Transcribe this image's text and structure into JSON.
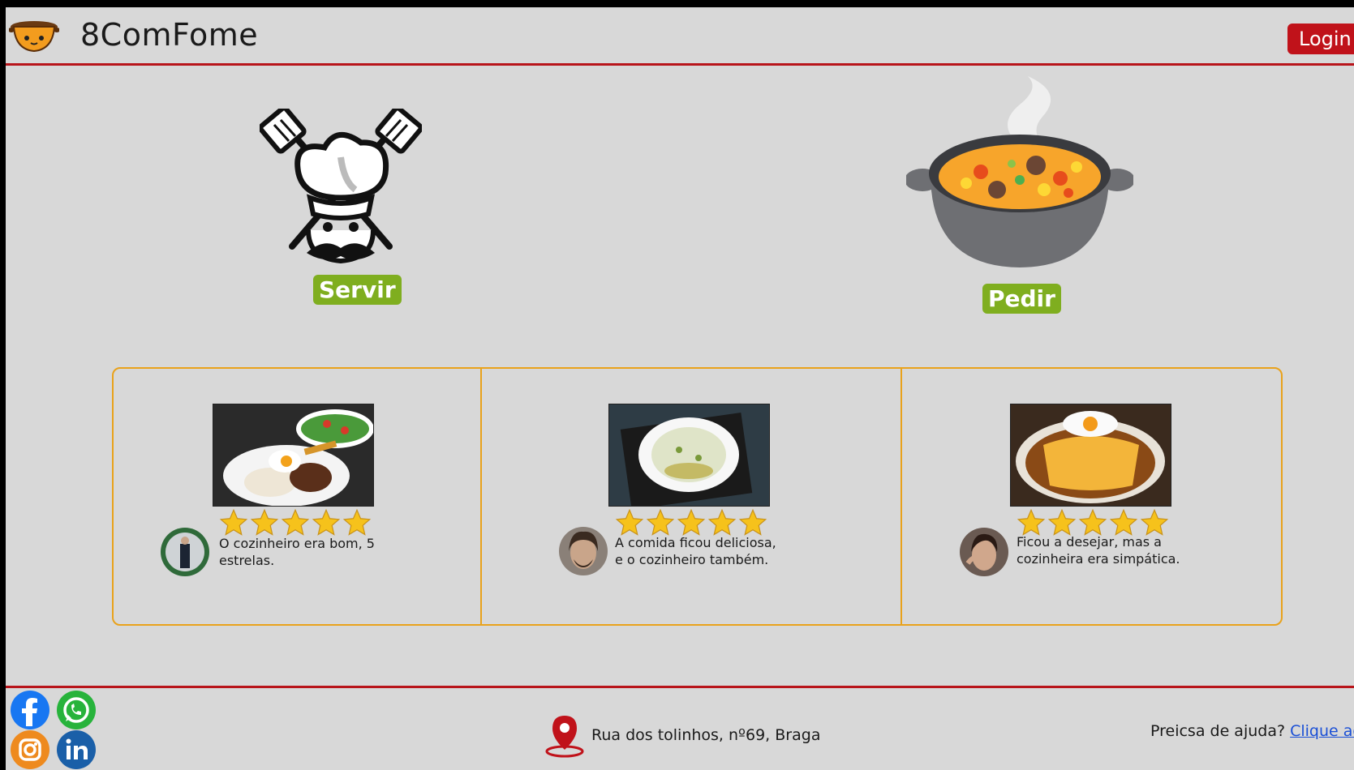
{
  "header": {
    "brand": "8ComFome",
    "login_label": "Login"
  },
  "choices": {
    "servir_label": "Servir",
    "pedir_label": "Pedir"
  },
  "reviews": [
    {
      "comment": "O cozinheiro era bom, 5 estrelas.",
      "rating": 5
    },
    {
      "comment": "A comida ficou deliciosa, e o cozinheiro também.",
      "rating": 5
    },
    {
      "comment": "Ficou a desejar, mas a cozinheira era simpática.",
      "rating": 5
    }
  ],
  "footer": {
    "address": "Rua dos tolinhos, nº69, Braga",
    "help_text": "Preicsa de ajuda?",
    "help_link": "Clique aqui",
    "social": [
      "facebook-icon",
      "whatsapp-icon",
      "instagram-icon",
      "linkedin-icon"
    ]
  },
  "colors": {
    "accent_red": "#b8141a",
    "tag_green": "#7fae1f",
    "review_border": "#e9a21b",
    "star": "#f6c21b"
  }
}
